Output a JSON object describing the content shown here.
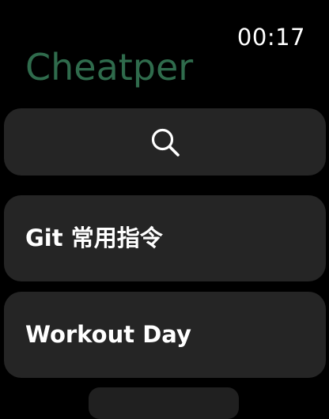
{
  "status_bar": {
    "time": "00:17"
  },
  "header": {
    "title": "Cheatper",
    "title_color": "#2f6b4c"
  },
  "search": {
    "icon": "search-icon"
  },
  "list": {
    "items": [
      {
        "label": "Git 常用指令"
      },
      {
        "label": "Workout Day"
      },
      {
        "label": ""
      }
    ]
  },
  "colors": {
    "background": "#000000",
    "card": "#252525",
    "text": "#ffffff"
  }
}
